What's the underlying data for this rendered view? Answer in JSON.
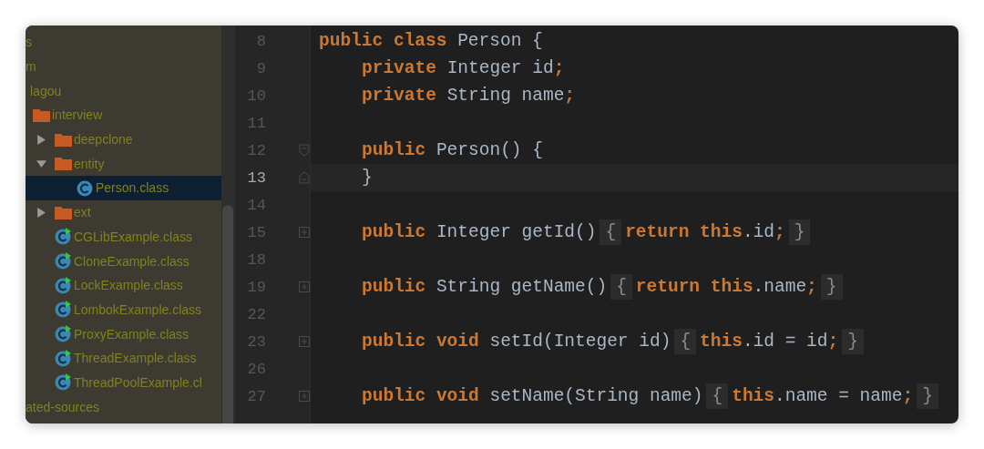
{
  "project_tree": {
    "items": [
      {
        "label": "s",
        "selected": false
      },
      {
        "label": "m",
        "selected": false,
        "children": [
          {
            "label": "lagou",
            "selected": false,
            "children": [
              {
                "label": "interview",
                "kind": "folder",
                "selected": false,
                "children": [
                  {
                    "label": "deepclone",
                    "kind": "folder",
                    "expanded": false,
                    "selected": false
                  },
                  {
                    "label": "entity",
                    "kind": "folder",
                    "expanded": true,
                    "selected": false,
                    "children": [
                      {
                        "label": "Person.class",
                        "kind": "class",
                        "selected": true
                      }
                    ]
                  },
                  {
                    "label": "ext",
                    "kind": "folder",
                    "expanded": false,
                    "selected": false
                  },
                  {
                    "label": "CGLibExample.class",
                    "kind": "runnable",
                    "selected": false
                  },
                  {
                    "label": "CloneExample.class",
                    "kind": "runnable",
                    "selected": false
                  },
                  {
                    "label": "LockExample.class",
                    "kind": "runnable",
                    "selected": false
                  },
                  {
                    "label": "LombokExample.class",
                    "kind": "runnable",
                    "selected": false
                  },
                  {
                    "label": "ProxyExample.class",
                    "kind": "runnable",
                    "selected": false
                  },
                  {
                    "label": "ThreadExample.class",
                    "kind": "runnable",
                    "selected": false
                  },
                  {
                    "label": "ThreadPoolExample.cl",
                    "kind": "runnable",
                    "selected": false
                  }
                ]
              }
            ]
          }
        ]
      },
      {
        "label": "ated-sources",
        "selected": false
      }
    ]
  },
  "editor": {
    "lines": [
      {
        "number": "8",
        "current": false,
        "tokens": [
          {
            "kind": "keyword",
            "text": "public class "
          },
          {
            "kind": "plain",
            "text": "Person {"
          }
        ],
        "children": [
          {
            "number": "9",
            "current": false,
            "tokens": [
              {
                "kind": "keyword",
                "text": "private "
              },
              {
                "kind": "plain",
                "text": "Integer id"
              },
              {
                "kind": "keyword",
                "text": ";"
              }
            ]
          },
          {
            "number": "10",
            "current": false,
            "tokens": [
              {
                "kind": "keyword",
                "text": "private "
              },
              {
                "kind": "plain",
                "text": "String name"
              },
              {
                "kind": "keyword",
                "text": ";"
              }
            ]
          },
          {
            "number": "11",
            "current": false
          },
          {
            "number": "12",
            "current": false,
            "kind": "fold_start",
            "tokens": [
              {
                "kind": "keyword",
                "text": "public "
              },
              {
                "kind": "plain",
                "text": "Person() {"
              }
            ]
          },
          {
            "number": "13",
            "current": true,
            "kind": "fold_end",
            "tokens": [
              {
                "kind": "plain",
                "text": "}"
              }
            ]
          },
          {
            "number": "14",
            "current": false
          },
          {
            "number": "15",
            "current": false,
            "kind": "collapsed",
            "tokens": [
              {
                "kind": "keyword",
                "text": "public "
              },
              {
                "kind": "plain",
                "text": "Integer getId()"
              },
              {
                "kind": "fold",
                "text": "{"
              },
              {
                "kind": "keyword",
                "text": "return this"
              },
              {
                "kind": "plain",
                "text": ".id"
              },
              {
                "kind": "keyword",
                "text": ";"
              },
              {
                "kind": "fold",
                "text": "}"
              }
            ]
          },
          {
            "number": "18",
            "current": false
          },
          {
            "number": "19",
            "current": false,
            "kind": "collapsed",
            "tokens": [
              {
                "kind": "keyword",
                "text": "public "
              },
              {
                "kind": "plain",
                "text": "String getName()"
              },
              {
                "kind": "fold",
                "text": "{"
              },
              {
                "kind": "keyword",
                "text": "return this"
              },
              {
                "kind": "plain",
                "text": ".name"
              },
              {
                "kind": "keyword",
                "text": ";"
              },
              {
                "kind": "fold",
                "text": "}"
              }
            ]
          },
          {
            "number": "22",
            "current": false
          },
          {
            "number": "23",
            "current": false,
            "kind": "collapsed",
            "tokens": [
              {
                "kind": "keyword",
                "text": "public void "
              },
              {
                "kind": "plain",
                "text": "setId(Integer id)"
              },
              {
                "kind": "fold",
                "text": "{"
              },
              {
                "kind": "keyword",
                "text": "this"
              },
              {
                "kind": "plain",
                "text": ".id = id"
              },
              {
                "kind": "keyword",
                "text": ";"
              },
              {
                "kind": "fold",
                "text": "}"
              }
            ]
          },
          {
            "number": "26",
            "current": false
          },
          {
            "number": "27",
            "current": false,
            "kind": "collapsed",
            "tokens": [
              {
                "kind": "keyword",
                "text": "public void "
              },
              {
                "kind": "plain",
                "text": "setName(String name)"
              },
              {
                "kind": "fold",
                "text": "{"
              },
              {
                "kind": "keyword",
                "text": "this"
              },
              {
                "kind": "plain",
                "text": ".name = name"
              },
              {
                "kind": "keyword",
                "text": ";"
              },
              {
                "kind": "fold",
                "text": "}"
              }
            ]
          }
        ]
      }
    ]
  }
}
